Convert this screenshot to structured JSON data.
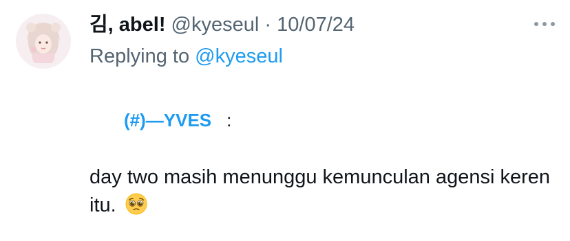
{
  "tweet": {
    "display_name": "김, abel!",
    "handle": "@kyeseul",
    "separator": "·",
    "date": "10/07/24",
    "replying_prefix": "Replying to",
    "replying_handle": "@kyeseul",
    "quoted_handle": "(#)—YVES",
    "quoted_colon": ":",
    "body": "day two masih menunggu kemunculan agensi keren itu."
  },
  "icons": {
    "more": "more-horizontal-icon",
    "emoji": "pleading-face-emoji"
  },
  "colors": {
    "link": "#1d9bf0",
    "secondary_text": "#536471",
    "primary_text": "#0f1419"
  }
}
